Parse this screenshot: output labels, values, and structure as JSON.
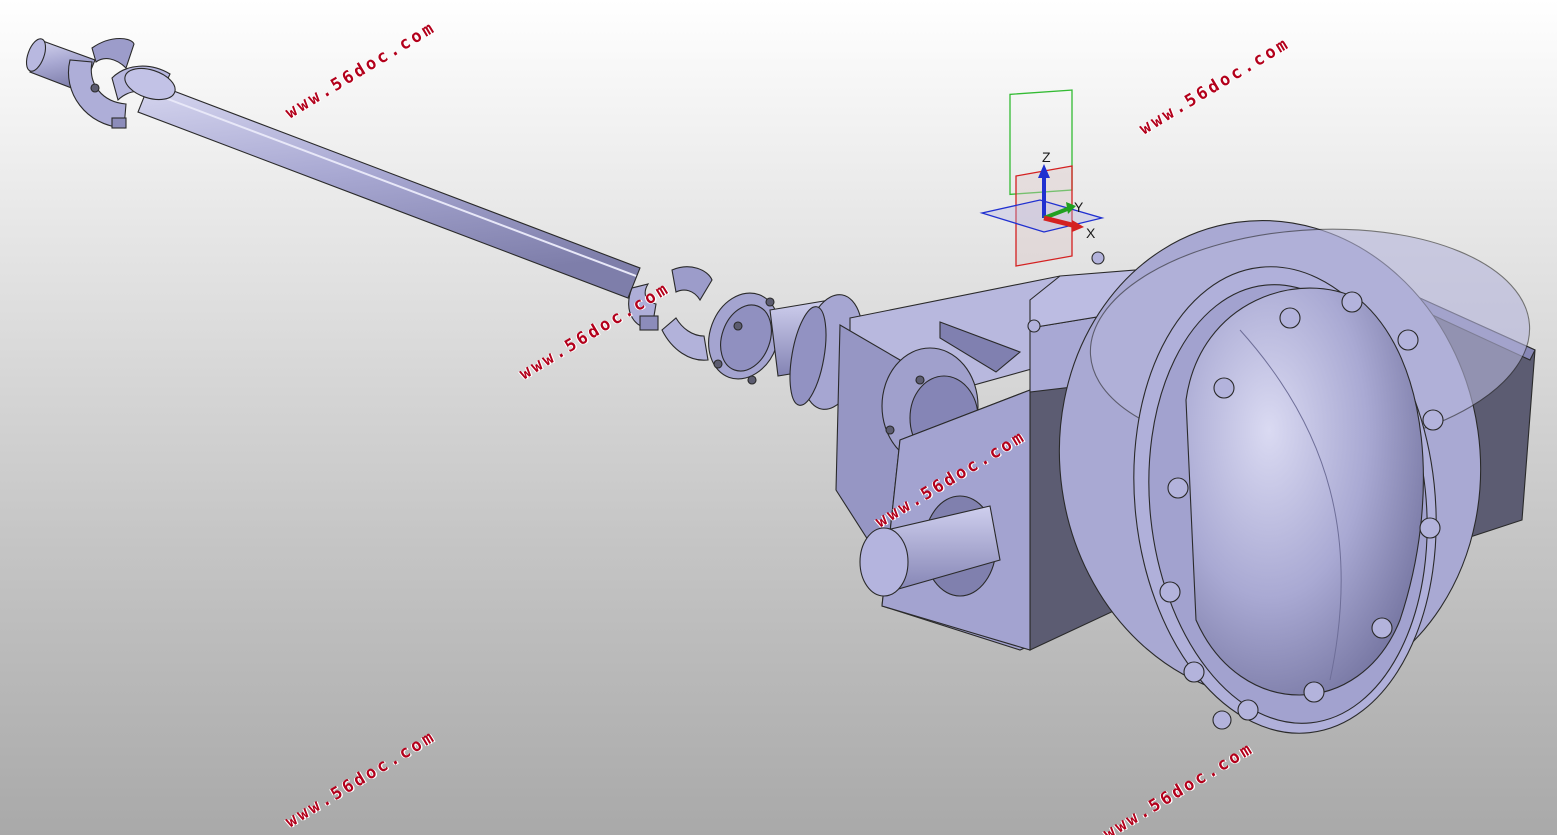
{
  "viewport": {
    "background": [
      "#ffffff",
      "#c5c5c5",
      "#a9a9a9"
    ],
    "part_color": "#aaaad4",
    "part_shadow": "#5c5c70",
    "edge_color": "#2a2a2a"
  },
  "compass": {
    "x_label": "X",
    "y_label": "Y",
    "z_label": "Z",
    "x_color": "#d4202a",
    "y_color": "#20a020",
    "z_color": "#2030d0"
  },
  "watermarks": [
    {
      "text": "www.56doc.com"
    },
    {
      "text": "www.56doc.com"
    },
    {
      "text": "www.56doc.com"
    },
    {
      "text": "www.56doc.com"
    },
    {
      "text": "www.56doc.com"
    },
    {
      "text": "www.56doc.com"
    }
  ]
}
